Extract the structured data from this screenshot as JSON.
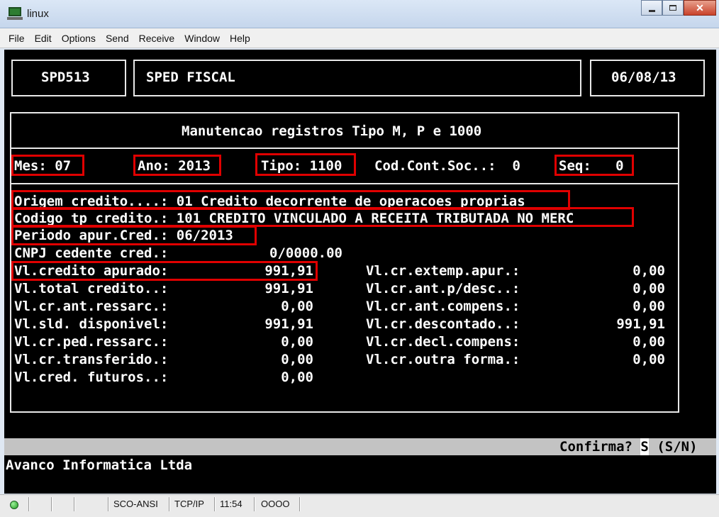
{
  "window": {
    "title": "linux",
    "icon": "terminal-monitor-icon"
  },
  "menu": [
    "File",
    "Edit",
    "Options",
    "Send",
    "Receive",
    "Window",
    "Help"
  ],
  "header": {
    "program": "SPD513",
    "module": "SPED FISCAL",
    "date": "06/08/13"
  },
  "screen_title": "Manutencao registros Tipo M, P e 1000",
  "keys": {
    "mes": "Mes: 07",
    "ano": "Ano: 2013",
    "tipo": "Tipo: 1100",
    "cod_cont": "Cod.Cont.Soc..:  0",
    "seq": "Seq:   0"
  },
  "details": {
    "origem": "Origem credito....: 01 Credito decorrente de operacoes proprias",
    "codigo": "Codigo tp credito.: 101 CREDITO VINCULADO A RECEITA TRIBUTADA NO MERC",
    "periodo": "Periodo apur.Cred.: 06/2013",
    "cnpj_label": "CNPJ cedente cred.:",
    "cnpj_value": "0/0000.00"
  },
  "left_fields": [
    {
      "label": "Vl.credito apurado:",
      "value": "991,91"
    },
    {
      "label": "Vl.total credito..:",
      "value": "991,91"
    },
    {
      "label": "Vl.cr.ant.ressarc.:",
      "value": "0,00"
    },
    {
      "label": "Vl.sld. disponivel:",
      "value": "991,91"
    },
    {
      "label": "Vl.cr.ped.ressarc.:",
      "value": "0,00"
    },
    {
      "label": "Vl.cr.transferido.:",
      "value": "0,00"
    },
    {
      "label": "Vl.cred. futuros..:",
      "value": "0,00"
    }
  ],
  "right_fields": [
    {
      "label": "Vl.cr.extemp.apur.:",
      "value": "0,00"
    },
    {
      "label": "Vl.cr.ant.p/desc..:",
      "value": "0,00"
    },
    {
      "label": "Vl.cr.ant.compens.:",
      "value": "0,00"
    },
    {
      "label": "Vl.cr.descontado..:",
      "value": "991,91"
    },
    {
      "label": "Vl.cr.decl.compens:",
      "value": "0,00"
    },
    {
      "label": "Vl.cr.outra forma.:",
      "value": "0,00"
    }
  ],
  "confirm": {
    "prompt": "Confirma?",
    "input": "S",
    "options": "(S/N)"
  },
  "company": "Avanco Informatica Ltda",
  "statusbar": {
    "encoding": "SCO-ANSI",
    "protocol": "TCP/IP",
    "time": "11:54",
    "indicator": "OOOO"
  },
  "colors": {
    "terminal_bg": "#000000",
    "terminal_fg": "#ffffff",
    "highlight": "#e00000",
    "confirm_bar": "#c3c3c3"
  }
}
